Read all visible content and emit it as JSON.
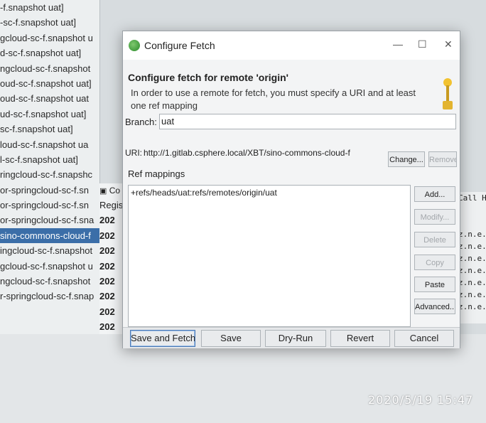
{
  "background": {
    "project_list": [
      "-f.snapshot uat]",
      "-sc-f.snapshot uat]",
      "gcloud-sc-f.snapshot u",
      "d-sc-f.snapshot uat]",
      "ngcloud-sc-f.snapshot",
      "oud-sc-f.snapshot uat]",
      "oud-sc-f.snapshot uat",
      "ud-sc-f.snapshot uat]",
      "sc-f.snapshot uat]",
      "loud-sc-f.snapshot ua",
      "l-sc-f.snapshot uat]",
      "ringcloud-sc-f.snapshc",
      "or-springcloud-sc-f.sn",
      "or-springcloud-sc-f.sn",
      "or-springcloud-sc-f.sna",
      "sino-commons-cloud-f",
      "ingcloud-sc-f.snapshot",
      "gcloud-sc-f.snapshot u",
      "ngcloud-sc-f.snapshot",
      "r-springcloud-sc-f.snap"
    ],
    "panel_tab": "Co",
    "panel_column_header": "Regis",
    "panel_rows": [
      "202",
      "202",
      "202",
      "202",
      "202",
      "202",
      "202",
      "202"
    ],
    "right_column": [
      "Call H",
      "",
      "",
      "z.n.e.r",
      "z.n.e.r",
      "z.n.e.r",
      "z.n.e.r",
      "z.n.e.r",
      "z.n.e.r",
      "z.n.e.r"
    ]
  },
  "dialog": {
    "title": "Configure Fetch",
    "minimize_glyph": "—",
    "maximize_glyph": "☐",
    "close_glyph": "✕",
    "heading": "Configure fetch for remote 'origin'",
    "hint": "In order to use a remote for fetch, you must specify a URI and at least one ref mapping",
    "branch_label": "Branch:",
    "branch_value": "uat",
    "uri_label": "URI:",
    "uri_value": "http://1.gitlab.csphere.local/XBT/sino-commons-cloud-f",
    "change_button": "Change...",
    "remove_button": "Remove",
    "ref_mappings_label": "Ref mappings",
    "ref_mappings": [
      "+refs/heads/uat:refs/remotes/origin/uat"
    ],
    "side_buttons": {
      "add": "Add...",
      "modify": "Modify...",
      "delete": "Delete",
      "copy": "Copy",
      "paste": "Paste",
      "advanced": "Advanced..."
    },
    "bottom_buttons": {
      "save_and_fetch": "Save and Fetch",
      "save": "Save",
      "dry_run": "Dry-Run",
      "revert": "Revert",
      "cancel": "Cancel"
    }
  },
  "overlay": {
    "timestamp": "2020/5/19  15:47"
  }
}
